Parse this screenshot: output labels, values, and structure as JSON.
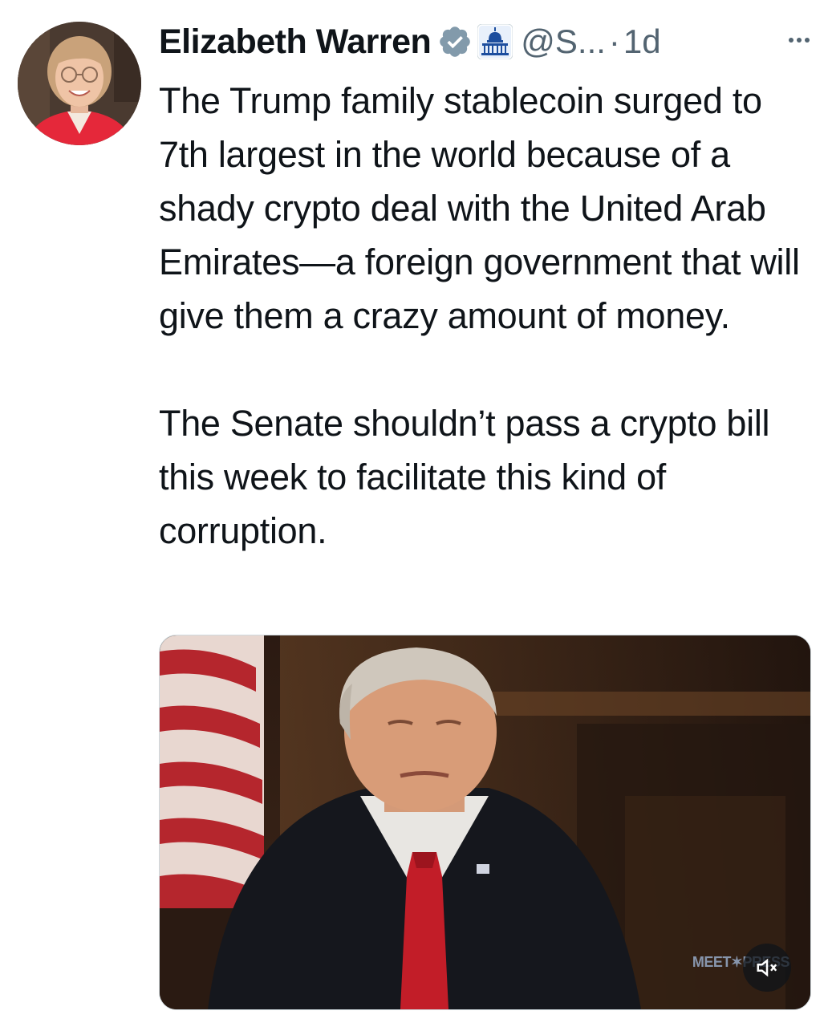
{
  "author": {
    "name": "Elizabeth Warren",
    "handle": "@S...",
    "separator": "·",
    "time": "1d"
  },
  "icons": {
    "verified": "verified-badge-icon",
    "affiliation": "capitol-building-icon",
    "more": "more-options-icon",
    "mute": "volume-muted-icon"
  },
  "tweet": {
    "paragraph1": "The Trump family stablecoin surged to 7th largest in the world because of a shady crypto deal with the United Arab Emirates—a foreign government that will give them a crazy amount of money.",
    "paragraph2": "The Senate shouldn’t pass a crypto bill this week to facilitate this kind of corruption."
  },
  "media": {
    "watermark": "MEET✶PRESS"
  },
  "colors": {
    "text": "#0f1419",
    "secondary": "#536471",
    "verified": "#829aab"
  }
}
